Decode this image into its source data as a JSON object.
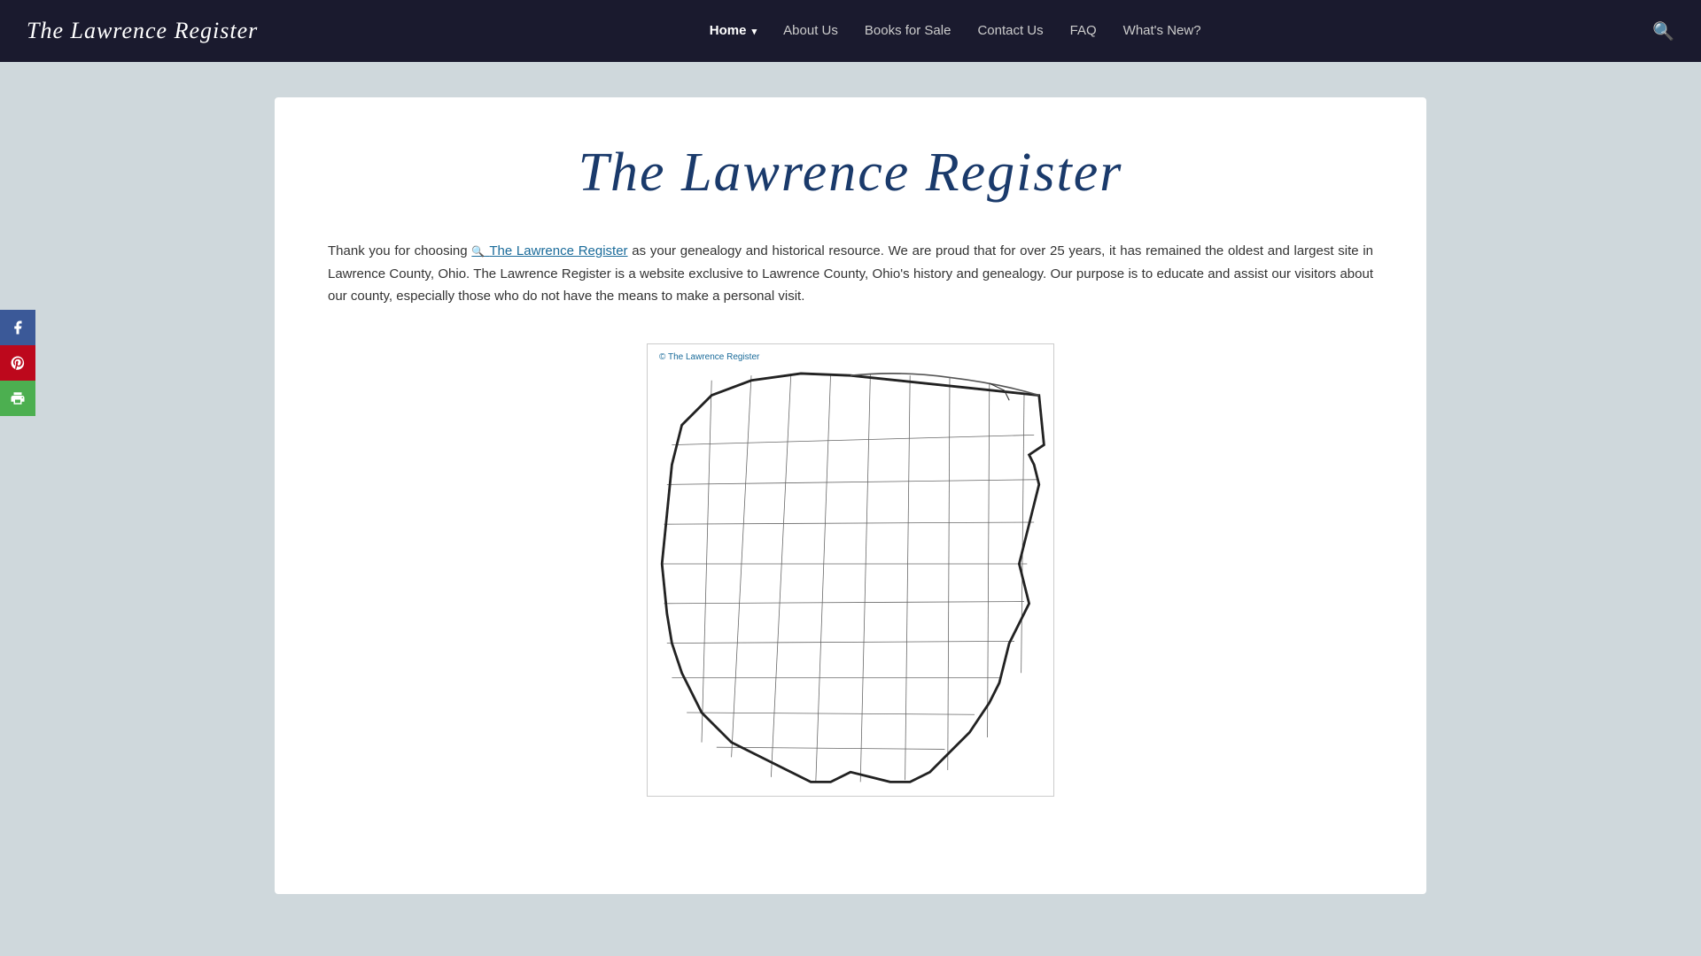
{
  "nav": {
    "logo": "The Lawrence Register",
    "links": [
      {
        "label": "Home",
        "active": true,
        "hasDropdown": true
      },
      {
        "label": "About Us",
        "active": false
      },
      {
        "label": "Books for Sale",
        "active": false
      },
      {
        "label": "Contact Us",
        "active": false
      },
      {
        "label": "FAQ",
        "active": false
      },
      {
        "label": "What's New?",
        "active": false
      }
    ]
  },
  "main": {
    "page_title": "The Lawrence Register",
    "intro_text_before_link": "Thank you for choosing ",
    "intro_link_text": "The Lawrence Register",
    "intro_text_after_link": " as your genealogy and historical resource. We are proud that for over 25 years, it has remained the oldest and largest site in Lawrence County, Ohio. The Lawrence Register is a website exclusive to Lawrence County, Ohio's history and genealogy. Our purpose is to educate and assist our visitors about our county, especially those who do not have the means to make a personal visit.",
    "map_caption": "© The Lawrence Register"
  },
  "social": {
    "facebook_label": "Facebook",
    "pinterest_label": "Pinterest",
    "print_label": "Print"
  },
  "colors": {
    "nav_bg": "#1a1a2e",
    "accent_blue": "#1a3a6b",
    "link_color": "#1a6b9a"
  }
}
